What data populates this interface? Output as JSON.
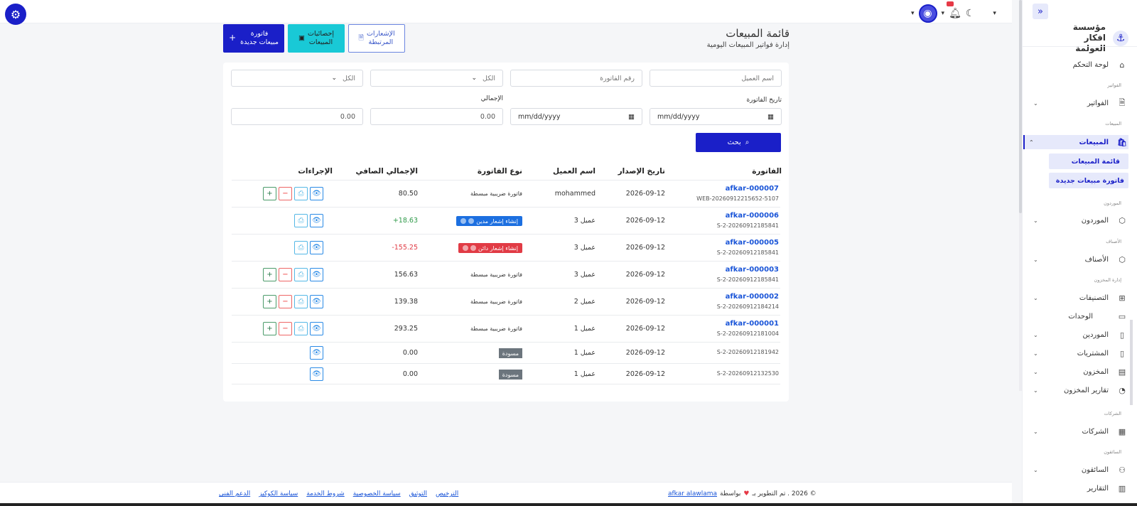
{
  "topbar": {
    "gear_icon": "gear-icon"
  },
  "header": {
    "title": "قائمة المبيعات",
    "subtitle": "إدارة فواتير المبيعات اليومية",
    "btn_related": "الإشعارات\nالمرتبطة",
    "btn_stats": "إحصائيات\nالمبيعات",
    "btn_new": "فاتورة\nمبيعات جديدة"
  },
  "filters": {
    "customer_placeholder": "اسم العميل",
    "invoice_placeholder": "رقم الفاتورة",
    "type_value": "الكل",
    "status_value": "الكل",
    "date_label": "تاريخ الفاتورة",
    "total_label": "الإجمالي",
    "date_from": "mm/dd/yyyy",
    "date_to": "mm/dd/yyyy",
    "total_from": "0.00",
    "total_to": "0.00",
    "search_label": "بحث"
  },
  "table": {
    "headers": {
      "invoice": "الفاتورة",
      "date": "تاريخ الإصدار",
      "customer": "اسم العميل",
      "type": "نوع الفاتورة",
      "net": "الإجمالي الصافي",
      "actions": "الإجراءات"
    },
    "rows": [
      {
        "no": "afkar-000007",
        "ref": "WEB-20260912215652-5107",
        "date": "2026-09-12",
        "customer": "mohammed",
        "type": "فاتورة ضريبية مبسطة",
        "net": "80.50"
      },
      {
        "no": "afkar-000006",
        "ref": "S-2-20260912185841",
        "date": "2026-09-12",
        "customer": "عميل 3",
        "type": "إنشاء إشعار مدين",
        "net": "18.63+"
      },
      {
        "no": "afkar-000005",
        "ref": "S-2-20260912185841",
        "date": "2026-09-12",
        "customer": "عميل 3",
        "type": "إنشاء إشعار دائن",
        "net": "155.25-"
      },
      {
        "no": "afkar-000003",
        "ref": "S-2-20260912185841",
        "date": "2026-09-12",
        "customer": "عميل 3",
        "type": "فاتورة ضريبية مبسطة",
        "net": "156.63"
      },
      {
        "no": "afkar-000002",
        "ref": "S-2-20260912184214",
        "date": "2026-09-12",
        "customer": "عميل 2",
        "type": "فاتورة ضريبية مبسطة",
        "net": "139.38"
      },
      {
        "no": "afkar-000001",
        "ref": "S-2-20260912181004",
        "date": "2026-09-12",
        "customer": "عميل 1",
        "type": "فاتورة ضريبية مبسطة",
        "net": "293.25"
      },
      {
        "no": "",
        "ref": "S-2-20260912181942",
        "date": "2026-09-12",
        "customer": "عميل 1",
        "type": "مسودة",
        "net": "0.00"
      },
      {
        "no": "",
        "ref": "S-2-20260912132530",
        "date": "2026-09-12",
        "customer": "عميل 1",
        "type": "مسودة",
        "net": "0.00"
      }
    ]
  },
  "footer": {
    "copyright": "© 2026 . تم التطوير بـ",
    "by": "بواسطة",
    "company_link": "afkar alawlama",
    "links": [
      "الترخيص",
      "التوثيق",
      "سياسة الخصوصية",
      "شروط الخدمة",
      "سياسة الكوكيز",
      "الدعم الفني"
    ]
  },
  "sidebar": {
    "brand": "مؤسسة افكار العولمة",
    "dashboard": "لوحة التحكم",
    "sec_invoices": "الفواتير",
    "invoices": "الفواتير",
    "sec_sales": "المبيعات",
    "sales": "المبيعات",
    "sales_list": "قائمة المبيعات",
    "new_sale": "فاتورة مبيعات جديدة",
    "sec_suppliers": "الموردون",
    "suppliers": "الموردون",
    "sec_categories": "الأصناف",
    "categories": "الأصناف",
    "sec_inventory": "إدارة المخزون",
    "classifications": "التصنيفات",
    "units": "الوحدات",
    "suppliers2": "الموردين",
    "purchases": "المشتريات",
    "stock": "المخزون",
    "stock_reports": "تقارير المخزون",
    "sec_companies": "الشركات",
    "companies": "الشركات",
    "sec_drivers": "السائقون",
    "drivers": "السائقون",
    "reports": "التقارير"
  }
}
